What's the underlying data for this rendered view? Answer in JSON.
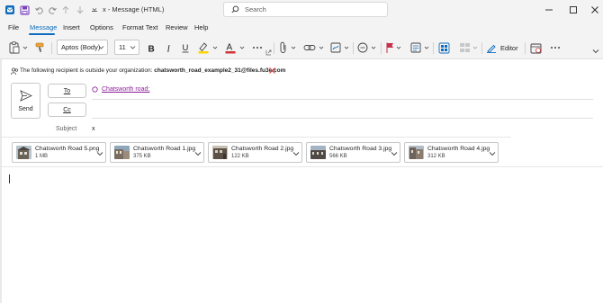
{
  "window": {
    "title": "x - Message (HTML)",
    "search_placeholder": "Search"
  },
  "menu": {
    "items": [
      "File",
      "Message",
      "Insert",
      "Options",
      "Format Text",
      "Review",
      "Help"
    ],
    "active": "Message"
  },
  "ribbon": {
    "font": "Aptos (Body)",
    "size": "11",
    "editor_label": "Editor"
  },
  "external_notice": {
    "prefix": "The following recipient is outside your organization:",
    "email": "chatsworth_road_example2_31@files.fu3e.com"
  },
  "compose": {
    "send_label": "Send",
    "to_label": "To",
    "cc_label": "Cc",
    "to_recipient": "Chatsworth road;",
    "subject_label": "Subject",
    "subject_value": "x"
  },
  "attachments": [
    {
      "name": "Chatsworth Road 5.png",
      "size": "1 MB"
    },
    {
      "name": "Chatsworth Road 1.jpg",
      "size": "375 KB"
    },
    {
      "name": "Chatsworth Road 2.jpg",
      "size": "122 KB"
    },
    {
      "name": "Chatsworth Road 3.jpg",
      "size": "566 KB"
    },
    {
      "name": "Chatsworth Road 4.jpg",
      "size": "312 KB"
    }
  ],
  "colors": {
    "accent": "#0f6cbd",
    "recipient_link": "#8b1a9a",
    "warning_red": "#d13438"
  },
  "icons": {
    "app": "outlook-icon",
    "save": "save-icon",
    "undo": "undo-icon",
    "redo": "redo-icon",
    "up": "arrow-up-icon",
    "down": "arrow-down-icon"
  }
}
